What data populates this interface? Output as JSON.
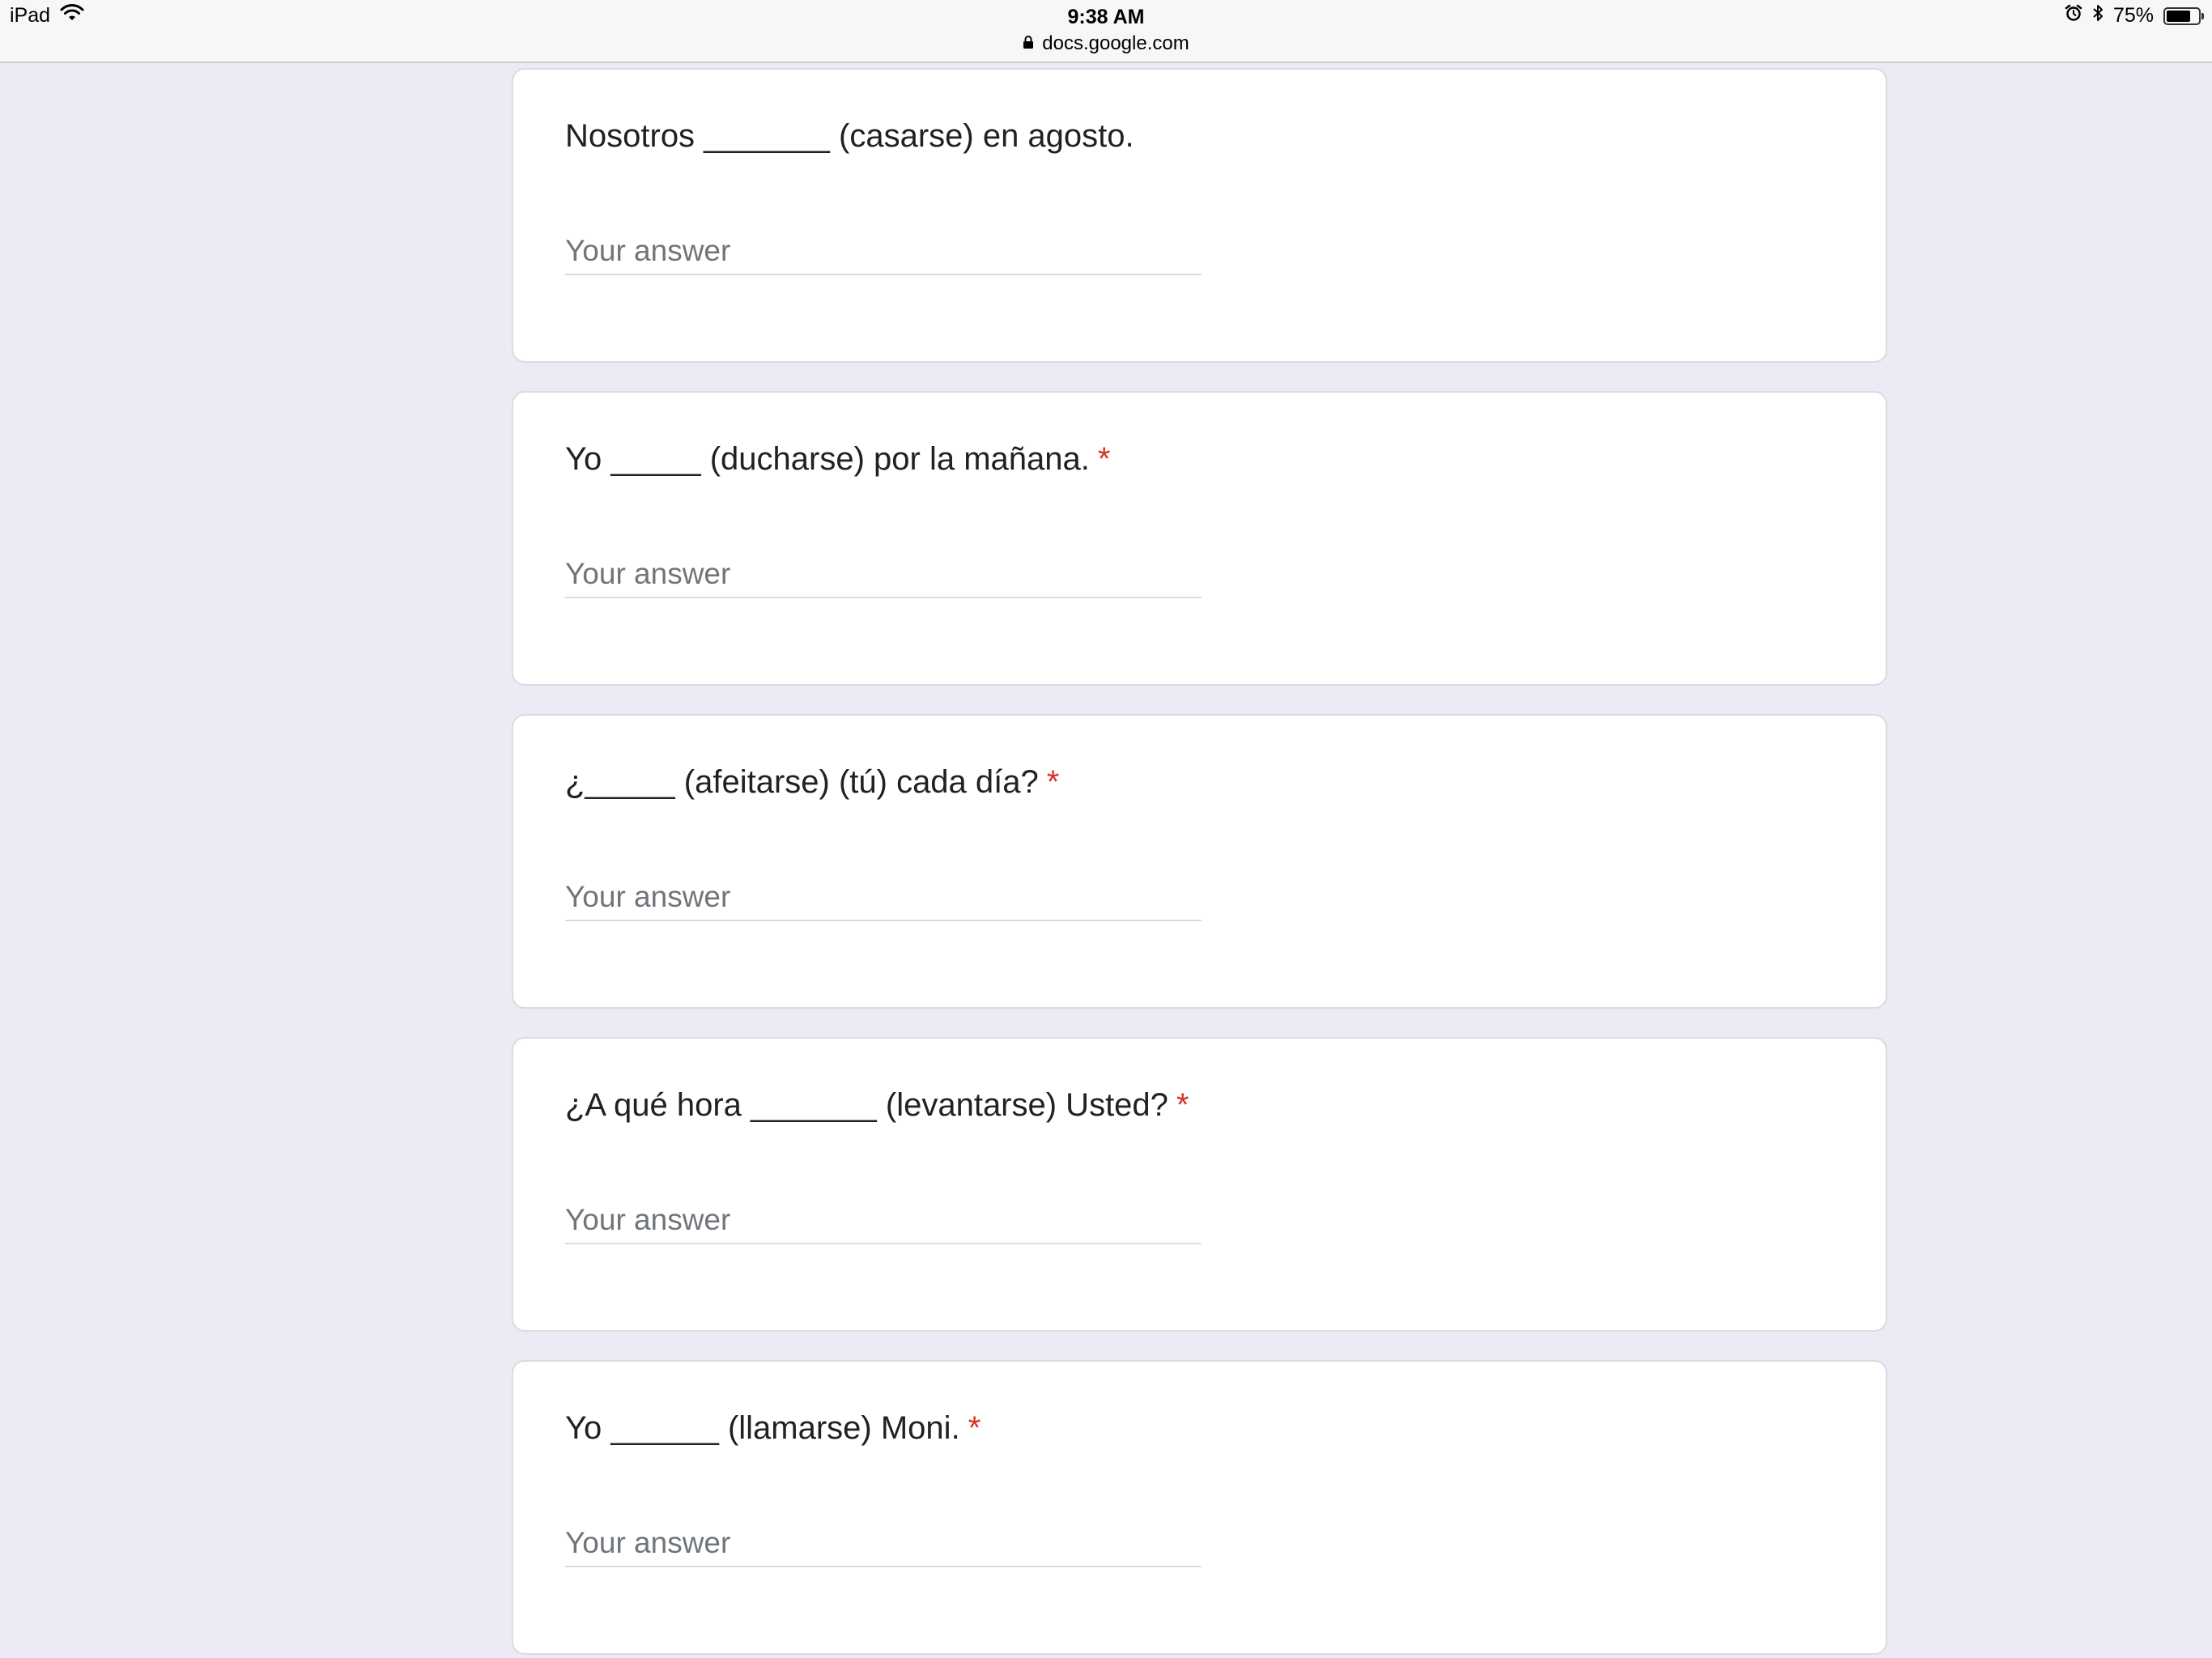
{
  "status_bar": {
    "device": "iPad",
    "time": "9:38 AM",
    "url": "docs.google.com",
    "battery_percent_label": "75%",
    "battery_level": 0.75,
    "icons": [
      "wifi-icon",
      "lock-icon",
      "alarm-icon",
      "bluetooth-icon",
      "battery-icon"
    ]
  },
  "form": {
    "questions": [
      {
        "text": "Nosotros _______ (casarse) en agosto.",
        "required": false,
        "asterisk": "",
        "placeholder": "Your answer",
        "value": ""
      },
      {
        "text": "Yo _____ (ducharse) por la mañana.",
        "required": true,
        "asterisk": "*",
        "placeholder": "Your answer",
        "value": ""
      },
      {
        "text": "¿_____ (afeitarse) (tú) cada día?",
        "required": true,
        "asterisk": "*",
        "placeholder": "Your answer",
        "value": ""
      },
      {
        "text": "¿A qué hora _______ (levantarse) Usted?",
        "required": true,
        "asterisk": "*",
        "placeholder": "Your answer",
        "value": ""
      },
      {
        "text": "Yo ______ (llamarse) Moni.",
        "required": true,
        "asterisk": "*",
        "placeholder": "Your answer",
        "value": ""
      }
    ]
  },
  "colors": {
    "page_background": "#ede9f5",
    "card_background": "#ffffff",
    "required_asterisk": "#d93025",
    "placeholder": "#70757a"
  }
}
